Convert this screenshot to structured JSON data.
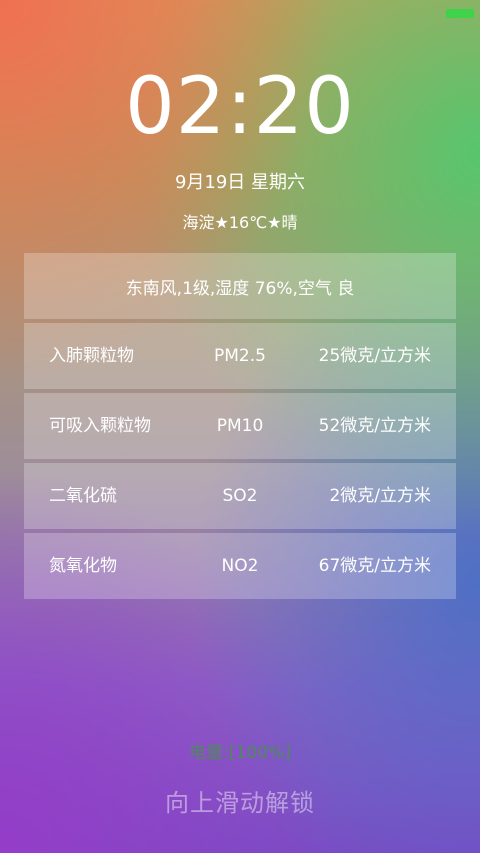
{
  "status_bar": {
    "battery_icon": "battery-icon",
    "battery_color": "#3fd24a"
  },
  "clock": {
    "time": "02:20",
    "date": "9月19日 星期六"
  },
  "weather": {
    "summary": "海淀★16℃★晴"
  },
  "air": {
    "wind_line": "东南风,1级,湿度 76%,空气 良",
    "rows": [
      {
        "name": "入肺颗粒物",
        "code": "PM2.5",
        "value": "25微克/立方米"
      },
      {
        "name": "可吸入颗粒物",
        "code": "PM10",
        "value": "52微克/立方米"
      },
      {
        "name": "二氧化硫",
        "code": "SO2",
        "value": "2微克/立方米"
      },
      {
        "name": "氮氧化物",
        "code": "NO2",
        "value": "67微克/立方米"
      }
    ]
  },
  "footer": {
    "power": "电量:[100%]",
    "unlock": "向上滑动解锁",
    "power_color": "#4f8a5a"
  }
}
